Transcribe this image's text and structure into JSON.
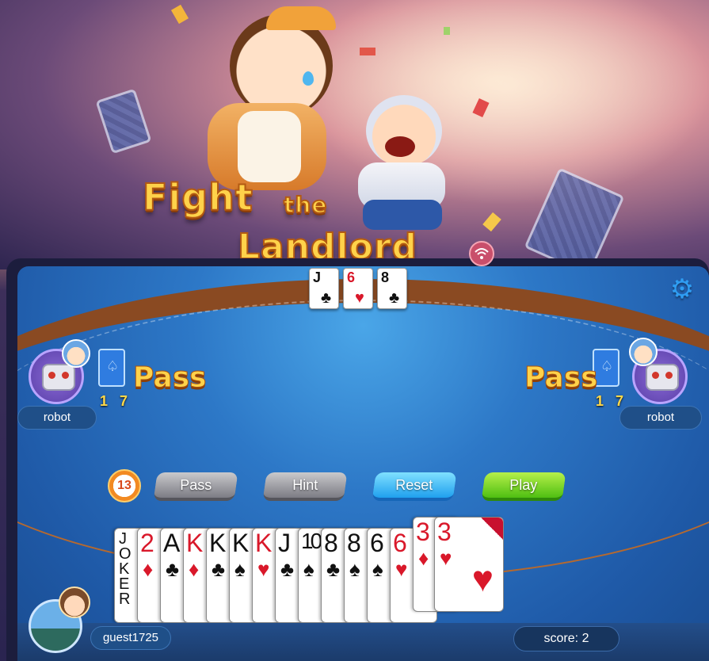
{
  "title": {
    "line1": "Fight",
    "line1b": "the",
    "line2": "Landlord"
  },
  "table_cards": [
    {
      "rank": "J",
      "suit": "♣",
      "color": "#111111"
    },
    {
      "rank": "6",
      "suit": "♥",
      "color": "#d9182a"
    },
    {
      "rank": "8",
      "suit": "♣",
      "color": "#111111"
    }
  ],
  "settings_icon": "gear-icon",
  "players": {
    "left": {
      "name": "robot",
      "cards_left": "1 7",
      "status": "Pass"
    },
    "right": {
      "name": "robot",
      "cards_left": "1 7",
      "status": "Pass"
    }
  },
  "timer": "13",
  "actions": {
    "pass": "Pass",
    "hint": "Hint",
    "reset": "Reset",
    "play": "Play"
  },
  "hand": [
    {
      "rank": "JOKER",
      "suit": "",
      "color": "black",
      "raised": false
    },
    {
      "rank": "2",
      "suit": "♦",
      "color": "red",
      "raised": false
    },
    {
      "rank": "A",
      "suit": "♣",
      "color": "black",
      "raised": false
    },
    {
      "rank": "K",
      "suit": "♦",
      "color": "red",
      "raised": false
    },
    {
      "rank": "K",
      "suit": "♣",
      "color": "black",
      "raised": false
    },
    {
      "rank": "K",
      "suit": "♠",
      "color": "black",
      "raised": false
    },
    {
      "rank": "K",
      "suit": "♥",
      "color": "red",
      "raised": false
    },
    {
      "rank": "J",
      "suit": "♣",
      "color": "black",
      "raised": false
    },
    {
      "rank": "10",
      "suit": "♠",
      "color": "black",
      "raised": false
    },
    {
      "rank": "8",
      "suit": "♣",
      "color": "black",
      "raised": false
    },
    {
      "rank": "8",
      "suit": "♠",
      "color": "black",
      "raised": false
    },
    {
      "rank": "6",
      "suit": "♠",
      "color": "black",
      "raised": false
    },
    {
      "rank": "6",
      "suit": "♥",
      "color": "red",
      "raised": false
    },
    {
      "rank": "3",
      "suit": "♦",
      "color": "red",
      "raised": true
    },
    {
      "rank": "3",
      "suit": "♥",
      "color": "red",
      "raised": true
    }
  ],
  "self": {
    "name": "guest1725",
    "score_label": "score",
    "score_sep": ":",
    "score": "2"
  }
}
